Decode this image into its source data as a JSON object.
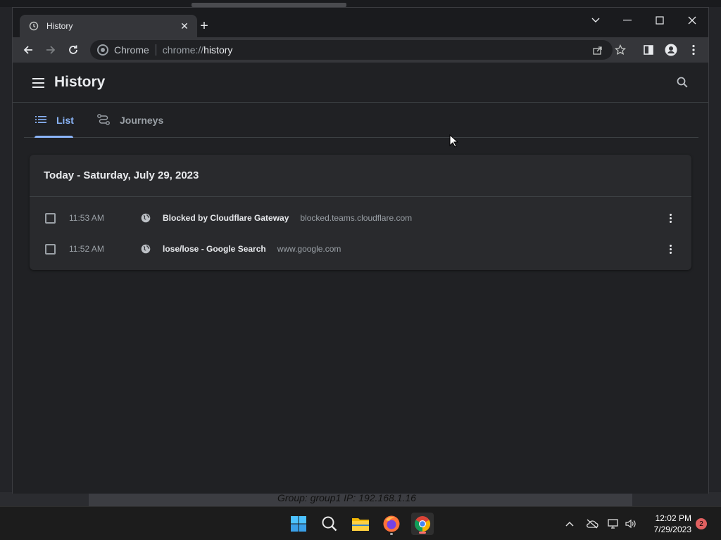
{
  "browser": {
    "tab_title": "History",
    "site_label": "Chrome",
    "url_scheme": "chrome://",
    "url_host": "history"
  },
  "history": {
    "title": "History",
    "tabs": [
      {
        "label": "List",
        "active": true
      },
      {
        "label": "Journeys",
        "active": false
      }
    ],
    "day_header": "Today - Saturday, July 29, 2023",
    "entries": [
      {
        "time": "11:53 AM",
        "title": "Blocked by Cloudflare Gateway",
        "domain": "blocked.teams.cloudflare.com"
      },
      {
        "time": "11:52 AM",
        "title": "lose/lose - Google Search",
        "domain": "www.google.com"
      }
    ]
  },
  "desktop": {
    "info_text": "Group: group1   IP: 192.168.1.16"
  },
  "taskbar": {
    "time": "12:02 PM",
    "date": "7/29/2023",
    "notification_count": "2"
  },
  "colors": {
    "accent": "#8ab4f8",
    "background": "#202124",
    "card": "#292a2d"
  }
}
